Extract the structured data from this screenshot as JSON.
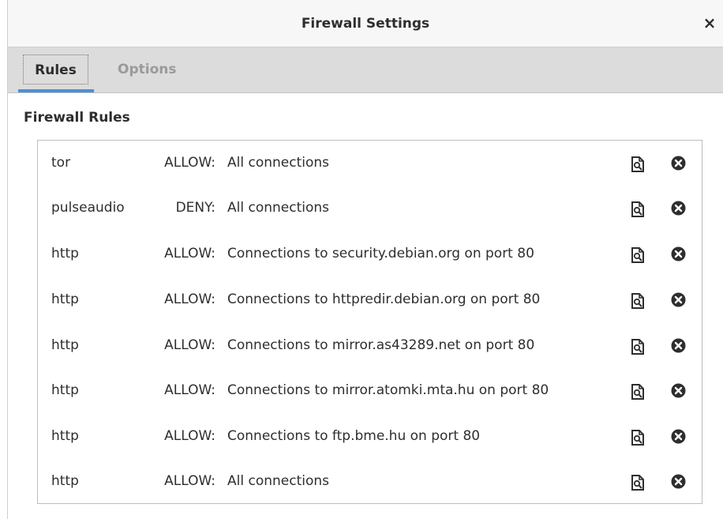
{
  "window": {
    "title": "Firewall Settings",
    "close_label": "×"
  },
  "tabs": [
    {
      "label": "Rules",
      "active": true
    },
    {
      "label": "Options",
      "active": false
    }
  ],
  "section": {
    "title": "Firewall Rules"
  },
  "rules": [
    {
      "app": "tor",
      "action": "ALLOW:",
      "description": "All connections"
    },
    {
      "app": "pulseaudio",
      "action": "DENY:",
      "description": "All connections"
    },
    {
      "app": "http",
      "action": "ALLOW:",
      "description": "Connections to security.debian.org on port 80"
    },
    {
      "app": "http",
      "action": "ALLOW:",
      "description": "Connections to httpredir.debian.org on port 80"
    },
    {
      "app": "http",
      "action": "ALLOW:",
      "description": "Connections to mirror.as43289.net on port 80"
    },
    {
      "app": "http",
      "action": "ALLOW:",
      "description": "Connections to mirror.atomki.mta.hu on port 80"
    },
    {
      "app": "http",
      "action": "ALLOW:",
      "description": "Connections to ftp.bme.hu on port 80"
    },
    {
      "app": "http",
      "action": "ALLOW:",
      "description": "All connections"
    }
  ],
  "icons": {
    "edit": "document-edit-icon",
    "delete": "delete-circle-icon"
  },
  "colors": {
    "accent": "#4a90d9",
    "tabbar_bg": "#dcdcdc",
    "inactive_tab": "#9a9a9a"
  }
}
